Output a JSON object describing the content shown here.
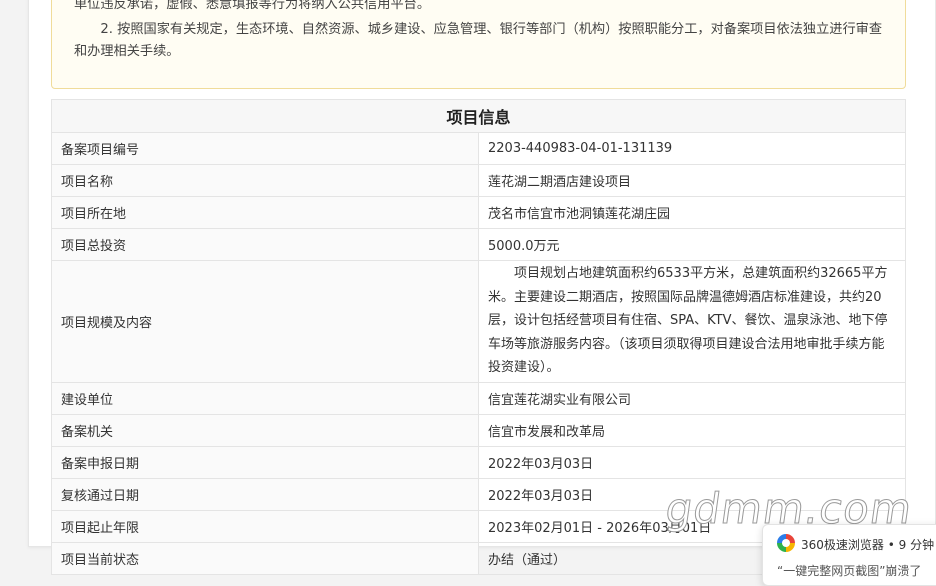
{
  "notice": {
    "line1": "单位违反承诺，虚假、悉意填报等行为将纳入公共信用平台。",
    "line2": "2. 按照国家有关规定，生态环境、自然资源、城乡建设、应急管理、银行等部门（机构）按照职能分工，对备案项目依法独立进行审查和办理相关手续。"
  },
  "project_info": {
    "title": "项目信息",
    "rows": [
      {
        "label": "备案项目编号",
        "value": "2203-440983-04-01-131139"
      },
      {
        "label": "项目名称",
        "value": "莲花湖二期酒店建设项目"
      },
      {
        "label": "项目所在地",
        "value": "茂名市信宜市池洞镇莲花湖庄园"
      },
      {
        "label": "项目总投资",
        "value": "5000.0万元"
      },
      {
        "label": "项目规模及内容",
        "value": "项目规划占地建筑面积约6533平方米，总建筑面积约32665平方米。主要建设二期酒店，按照国际品牌温德姆酒店标准建设，共约20层，设计包括经营项目有住宿、SPA、KTV、餐饮、温泉泳池、地下停车场等旅游服务内容。（该项目须取得项目建设合法用地审批手续方能投资建设）。"
      },
      {
        "label": "建设单位",
        "value": "信宜莲花湖实业有限公司"
      },
      {
        "label": "备案机关",
        "value": "信宜市发展和改革局"
      },
      {
        "label": "备案申报日期",
        "value": "2022年03月03日"
      },
      {
        "label": "复核通过日期",
        "value": "2022年03月03日"
      },
      {
        "label": "项目起止年限",
        "value": "2023年02月01日 - 2026年03月01日"
      },
      {
        "label": "项目当前状态",
        "value": "办结（通过）"
      }
    ]
  },
  "watermark": "gdmm.com",
  "toast": {
    "app": "360极速浏览器",
    "time": "• 9 分钟",
    "message": "“一键完整网页截图”崩溃了"
  },
  "icons": {
    "toast_logo": "browser-logo-icon"
  }
}
